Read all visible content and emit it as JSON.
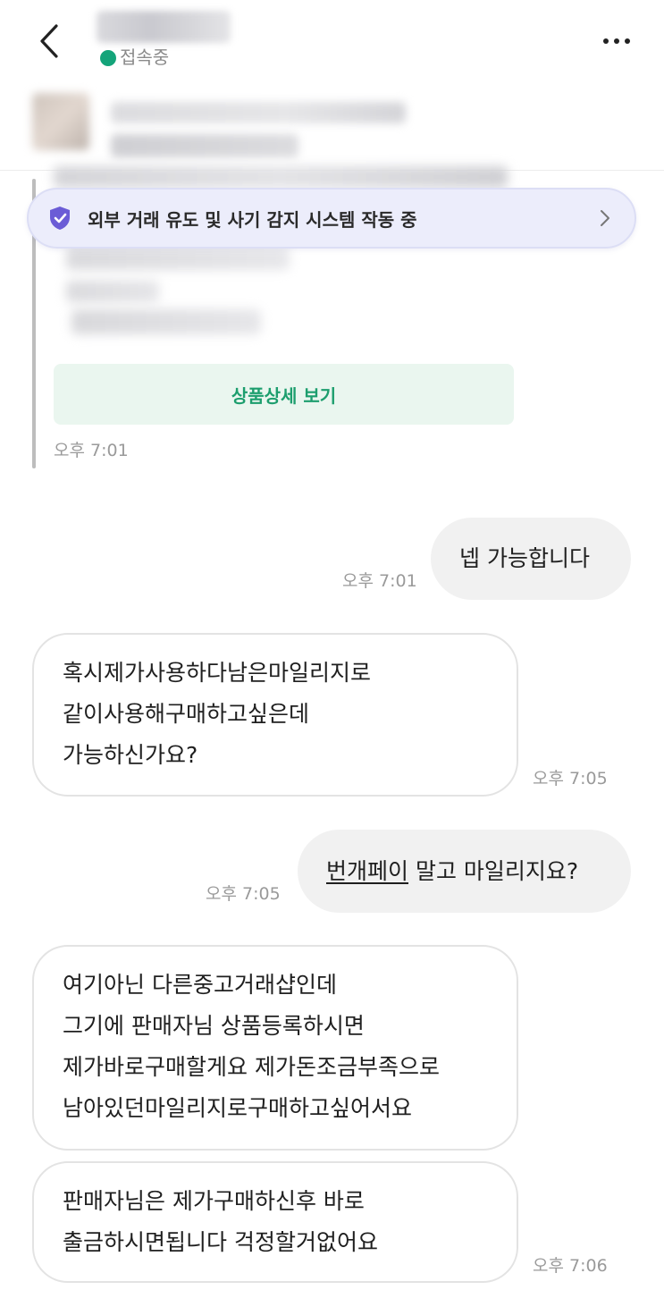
{
  "header": {
    "status_text": "접속중",
    "status_color": "#14a47a",
    "back_icon": "chevron-left-icon",
    "more_icon": "more-horizontal-icon"
  },
  "banner": {
    "text": "외부 거래 유도 및 사기 감지 시스템 작동 중",
    "icon": "shield-check-icon",
    "accent": "#6b5cd6"
  },
  "product_card": {
    "view_button_label": "상품상세 보기",
    "timestamp": "오후 7:01",
    "button_color": "#1d9e6e"
  },
  "messages": [
    {
      "side": "out",
      "text": "넵 가능합니다",
      "timestamp": "오후 7:01"
    },
    {
      "side": "in",
      "lines": [
        "혹시제가사용하다남은마일리지로",
        "같이사용해구매하고싶은데",
        "가능하신가요?"
      ],
      "timestamp": "오후 7:05"
    },
    {
      "side": "out",
      "link_text": "번개페이",
      "rest_text": " 말고 마일리지요?",
      "timestamp": "오후 7:05"
    },
    {
      "side": "in",
      "lines": [
        "여기아닌 다른중고거래샵인데",
        "그기에 판매자님 상품등록하시면",
        "제가바로구매할게요 제가돈조금부족으로",
        "남아있던마일리지로구매하고싶어서요"
      ]
    },
    {
      "side": "in",
      "lines": [
        "판매자님은 제가구매하신후 바로",
        "출금하시면됩니다 걱정할거없어요"
      ],
      "timestamp": "오후 7:06"
    }
  ]
}
